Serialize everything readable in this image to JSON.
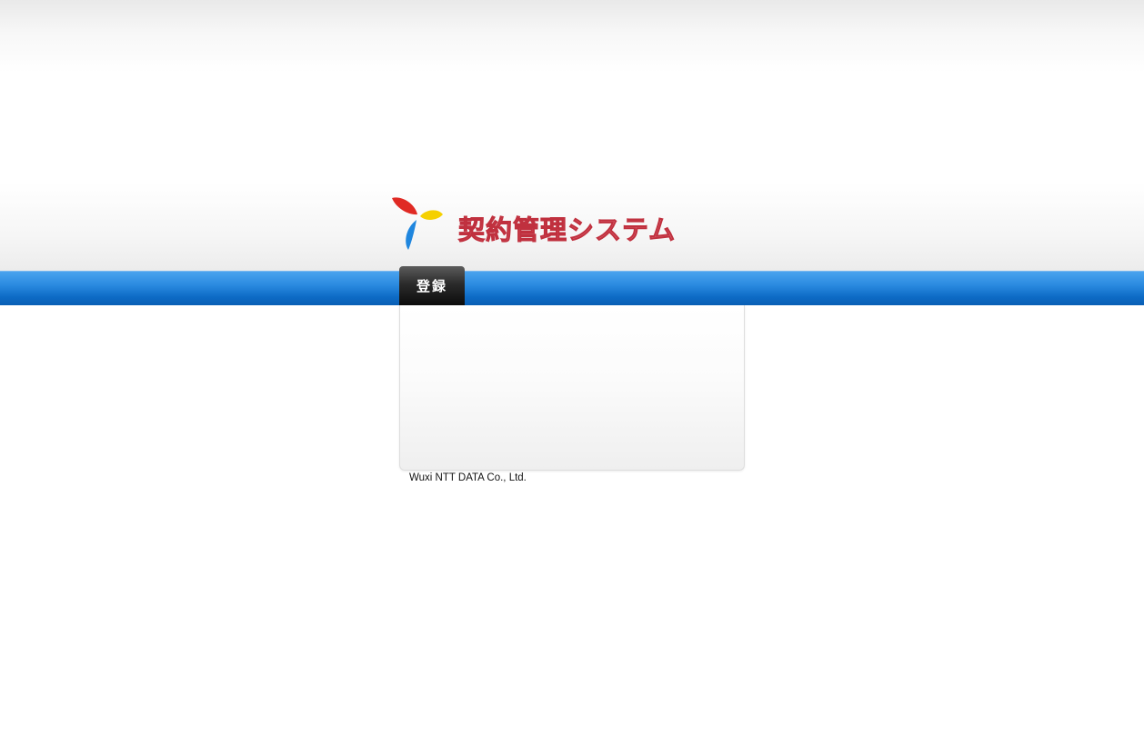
{
  "app": {
    "title": "契約管理システム",
    "logo_icon": "tricolor-petal-logo-icon"
  },
  "tabs": {
    "login_label": "登録"
  },
  "footer": {
    "company": "Wuxi NTT DATA Co., Ltd."
  },
  "decoration": {
    "image": "cotton-bolls-image"
  },
  "colors": {
    "accent_blue": "#1a7fd8",
    "title_red": "#d9485a",
    "tab_dark": "#1a1a1a"
  }
}
